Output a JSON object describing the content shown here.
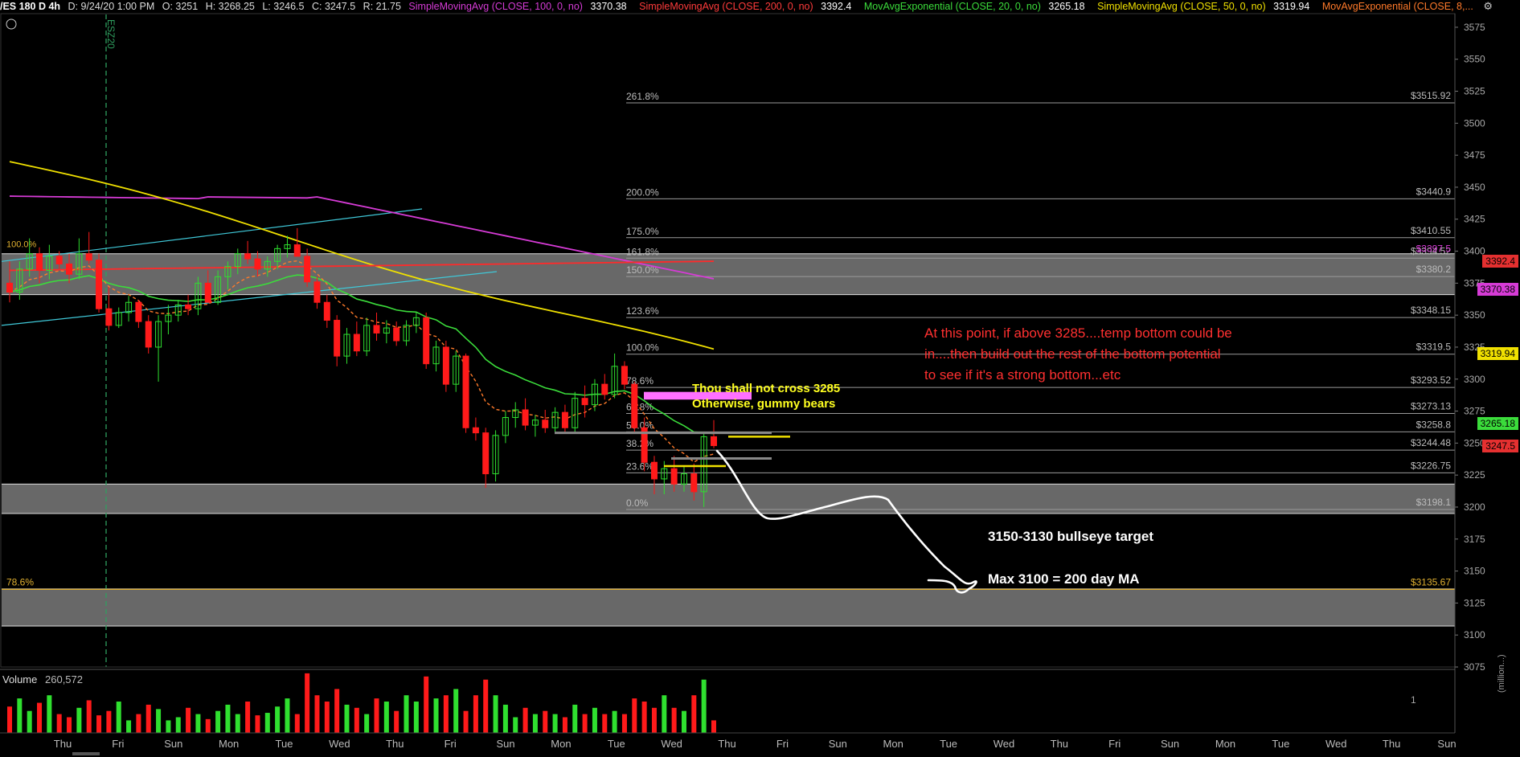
{
  "header": {
    "symbol": "/ES 180 D 4h",
    "date": "D: 9/24/20 1:00 PM",
    "open": "O: 3251",
    "high": "H: 3268.25",
    "low": "L: 3246.5",
    "close": "C: 3247.5",
    "range": "R: 21.75",
    "studies": [
      {
        "label": "SimpleMovingAvg (CLOSE, 100, 0, no)",
        "value": "3370.38",
        "color": "#d63bd6"
      },
      {
        "label": "SimpleMovingAvg (CLOSE, 200, 0, no)",
        "value": "3392.4",
        "color": "#ff3b3b"
      },
      {
        "label": "MovAvgExponential (CLOSE, 20, 0, no)",
        "value": "3265.18",
        "color": "#3bdc3b"
      },
      {
        "label": "SimpleMovingAvg (CLOSE, 50, 0, no)",
        "value": "3319.94",
        "color": "#f0e000"
      },
      {
        "label": "MovAvgExponential (CLOSE, 8,...",
        "value": "",
        "color": "#ff7a2a"
      }
    ],
    "expiry_label": "ESZ20"
  },
  "price_axis": [
    "3575",
    "3550",
    "3525",
    "3500",
    "3475",
    "3450",
    "3425",
    "3400",
    "3375",
    "3350",
    "3325",
    "3300",
    "3275",
    "3250",
    "3225",
    "3200",
    "3175",
    "3150",
    "3125",
    "3100",
    "3075"
  ],
  "fib_levels": [
    {
      "pct": "261.8%",
      "price": "$3515.92",
      "value": 3515.92
    },
    {
      "pct": "200.0%",
      "price": "$3440.9",
      "value": 3440.9
    },
    {
      "pct": "175.0%",
      "price": "$3410.55",
      "value": 3410.55
    },
    {
      "pct": "161.8%",
      "price": "$3394.52",
      "value": 3394.52
    },
    {
      "pct": "150.0%",
      "price": "$3380.2",
      "value": 3380.2
    },
    {
      "pct": "123.6%",
      "price": "$3348.15",
      "value": 3348.15
    },
    {
      "pct": "100.0%",
      "price": "$3319.5",
      "value": 3319.5
    },
    {
      "pct": "78.6%",
      "price": "$3293.52",
      "value": 3293.52
    },
    {
      "pct": "61.8%",
      "price": "$3273.13",
      "value": 3273.13
    },
    {
      "pct": "50.0%",
      "price": "$3258.8",
      "value": 3258.8
    },
    {
      "pct": "38.2%",
      "price": "$3244.48",
      "value": 3244.48
    },
    {
      "pct": "23.6%",
      "price": "$3226.75",
      "value": 3226.75
    },
    {
      "pct": "0.0%",
      "price": "$3198.1",
      "value": 3198.1
    }
  ],
  "extra_fib": {
    "pct": "78.6%",
    "price": "$3135.67",
    "value": 3135.67
  },
  "overlap_label": "$3397.5",
  "left_pct_label": "100.0%",
  "price_pills": [
    {
      "text": "3392.4",
      "value": 3392.4,
      "bg": "#e53030",
      "fg": "#000"
    },
    {
      "text": "3370.38",
      "value": 3370.38,
      "bg": "#d63bd6",
      "fg": "#000"
    },
    {
      "text": "3319.94",
      "value": 3319.94,
      "bg": "#f0e000",
      "fg": "#000"
    },
    {
      "text": "3265.18",
      "value": 3265.18,
      "bg": "#3bdc3b",
      "fg": "#000"
    },
    {
      "text": "3247.5",
      "value": 3247.5,
      "bg": "#e53030",
      "fg": "#000"
    }
  ],
  "annotations": {
    "red_note_1": "At this point, if above 3285....temp bottom could be",
    "red_note_2": "in....then build out the rest of the bottom potential",
    "red_note_3": "to see if it's a strong bottom...etc",
    "yellow_note_1": "Thou shall not cross 3285",
    "yellow_note_2": "Otherwise, gummy bears",
    "target_note": "3150-3130 bullseye target",
    "max_note": "Max 3100 = 200 day MA"
  },
  "volume": {
    "label": "Volume",
    "value": "260,572",
    "axis_top": "1",
    "axis_unit": "(million...)"
  },
  "time_axis": [
    "Thu",
    "Fri",
    "Sun",
    "Mon",
    "Tue",
    "Wed",
    "Thu",
    "Fri",
    "Sun",
    "Mon",
    "Tue",
    "Wed",
    "Thu",
    "Fri",
    "Sun",
    "Mon",
    "Tue",
    "Wed",
    "Thu",
    "Fri",
    "Sun",
    "Mon",
    "Tue",
    "Wed",
    "Thu",
    "Sun"
  ],
  "colors": {
    "up": "#2fe02f",
    "down": "#ff1a1a",
    "zone": "#7a7a7a",
    "fib_line": "#9a9a9a",
    "ma100": "#d63bd6",
    "ma200": "#ff2a2a",
    "ema20": "#3bdc3b",
    "ma50": "#f0e000",
    "ema8": "#ff7a2a",
    "channel": "#3fc8d8"
  },
  "chart_data": {
    "type": "candlestick",
    "title": "/ES 180 D 4h",
    "ylim": [
      3075,
      3585
    ],
    "candles": [
      {
        "o": 3375,
        "h": 3392,
        "l": 3360,
        "c": 3368
      },
      {
        "o": 3368,
        "h": 3392,
        "l": 3362,
        "c": 3386
      },
      {
        "o": 3386,
        "h": 3410,
        "l": 3380,
        "c": 3398
      },
      {
        "o": 3398,
        "h": 3403,
        "l": 3375,
        "c": 3385
      },
      {
        "o": 3385,
        "h": 3405,
        "l": 3378,
        "c": 3396
      },
      {
        "o": 3396,
        "h": 3400,
        "l": 3386,
        "c": 3390
      },
      {
        "o": 3390,
        "h": 3398,
        "l": 3375,
        "c": 3382
      },
      {
        "o": 3382,
        "h": 3410,
        "l": 3378,
        "c": 3398
      },
      {
        "o": 3398,
        "h": 3415,
        "l": 3390,
        "c": 3393
      },
      {
        "o": 3393,
        "h": 3398,
        "l": 3352,
        "c": 3355
      },
      {
        "o": 3355,
        "h": 3372,
        "l": 3338,
        "c": 3342
      },
      {
        "o": 3342,
        "h": 3356,
        "l": 3340,
        "c": 3352
      },
      {
        "o": 3352,
        "h": 3365,
        "l": 3345,
        "c": 3360
      },
      {
        "o": 3360,
        "h": 3362,
        "l": 3340,
        "c": 3345
      },
      {
        "o": 3345,
        "h": 3350,
        "l": 3320,
        "c": 3325
      },
      {
        "o": 3325,
        "h": 3350,
        "l": 3298,
        "c": 3345
      },
      {
        "o": 3345,
        "h": 3358,
        "l": 3335,
        "c": 3350
      },
      {
        "o": 3350,
        "h": 3362,
        "l": 3345,
        "c": 3358
      },
      {
        "o": 3358,
        "h": 3366,
        "l": 3350,
        "c": 3355
      },
      {
        "o": 3355,
        "h": 3380,
        "l": 3350,
        "c": 3375
      },
      {
        "o": 3375,
        "h": 3385,
        "l": 3365,
        "c": 3360
      },
      {
        "o": 3360,
        "h": 3385,
        "l": 3358,
        "c": 3380
      },
      {
        "o": 3380,
        "h": 3392,
        "l": 3370,
        "c": 3388
      },
      {
        "o": 3388,
        "h": 3402,
        "l": 3382,
        "c": 3398
      },
      {
        "o": 3398,
        "h": 3408,
        "l": 3390,
        "c": 3394
      },
      {
        "o": 3394,
        "h": 3400,
        "l": 3380,
        "c": 3386
      },
      {
        "o": 3386,
        "h": 3396,
        "l": 3380,
        "c": 3392
      },
      {
        "o": 3392,
        "h": 3405,
        "l": 3386,
        "c": 3402
      },
      {
        "o": 3402,
        "h": 3412,
        "l": 3395,
        "c": 3405
      },
      {
        "o": 3405,
        "h": 3418,
        "l": 3400,
        "c": 3396
      },
      {
        "o": 3396,
        "h": 3402,
        "l": 3372,
        "c": 3376
      },
      {
        "o": 3376,
        "h": 3380,
        "l": 3355,
        "c": 3360
      },
      {
        "o": 3360,
        "h": 3366,
        "l": 3340,
        "c": 3346
      },
      {
        "o": 3346,
        "h": 3350,
        "l": 3310,
        "c": 3318
      },
      {
        "o": 3318,
        "h": 3340,
        "l": 3312,
        "c": 3335
      },
      {
        "o": 3335,
        "h": 3345,
        "l": 3318,
        "c": 3322
      },
      {
        "o": 3322,
        "h": 3348,
        "l": 3318,
        "c": 3342
      },
      {
        "o": 3342,
        "h": 3352,
        "l": 3330,
        "c": 3336
      },
      {
        "o": 3336,
        "h": 3346,
        "l": 3328,
        "c": 3340
      },
      {
        "o": 3340,
        "h": 3345,
        "l": 3326,
        "c": 3330
      },
      {
        "o": 3330,
        "h": 3346,
        "l": 3326,
        "c": 3342
      },
      {
        "o": 3342,
        "h": 3352,
        "l": 3336,
        "c": 3348
      },
      {
        "o": 3348,
        "h": 3352,
        "l": 3308,
        "c": 3312
      },
      {
        "o": 3312,
        "h": 3330,
        "l": 3306,
        "c": 3325
      },
      {
        "o": 3325,
        "h": 3330,
        "l": 3290,
        "c": 3296
      },
      {
        "o": 3296,
        "h": 3322,
        "l": 3290,
        "c": 3318
      },
      {
        "o": 3318,
        "h": 3320,
        "l": 3258,
        "c": 3262
      },
      {
        "o": 3262,
        "h": 3270,
        "l": 3252,
        "c": 3258
      },
      {
        "o": 3258,
        "h": 3262,
        "l": 3215,
        "c": 3226
      },
      {
        "o": 3226,
        "h": 3260,
        "l": 3220,
        "c": 3256
      },
      {
        "o": 3256,
        "h": 3275,
        "l": 3250,
        "c": 3270
      },
      {
        "o": 3270,
        "h": 3282,
        "l": 3262,
        "c": 3276
      },
      {
        "o": 3276,
        "h": 3285,
        "l": 3260,
        "c": 3264
      },
      {
        "o": 3264,
        "h": 3272,
        "l": 3255,
        "c": 3268
      },
      {
        "o": 3268,
        "h": 3276,
        "l": 3258,
        "c": 3262
      },
      {
        "o": 3262,
        "h": 3278,
        "l": 3258,
        "c": 3274
      },
      {
        "o": 3274,
        "h": 3280,
        "l": 3258,
        "c": 3262
      },
      {
        "o": 3262,
        "h": 3290,
        "l": 3258,
        "c": 3285
      },
      {
        "o": 3285,
        "h": 3295,
        "l": 3270,
        "c": 3280
      },
      {
        "o": 3280,
        "h": 3300,
        "l": 3275,
        "c": 3296
      },
      {
        "o": 3296,
        "h": 3304,
        "l": 3284,
        "c": 3288
      },
      {
        "o": 3288,
        "h": 3320,
        "l": 3285,
        "c": 3310
      },
      {
        "o": 3310,
        "h": 3314,
        "l": 3292,
        "c": 3296
      },
      {
        "o": 3296,
        "h": 3298,
        "l": 3258,
        "c": 3262
      },
      {
        "o": 3262,
        "h": 3270,
        "l": 3228,
        "c": 3235
      },
      {
        "o": 3235,
        "h": 3240,
        "l": 3210,
        "c": 3222
      },
      {
        "o": 3222,
        "h": 3236,
        "l": 3210,
        "c": 3230
      },
      {
        "o": 3230,
        "h": 3240,
        "l": 3212,
        "c": 3218
      },
      {
        "o": 3218,
        "h": 3232,
        "l": 3212,
        "c": 3226
      },
      {
        "o": 3226,
        "h": 3234,
        "l": 3205,
        "c": 3212
      },
      {
        "o": 3212,
        "h": 3258,
        "l": 3200,
        "c": 3255
      },
      {
        "o": 3255,
        "h": 3268,
        "l": 3246,
        "c": 3248
      }
    ],
    "volume": [
      0.42,
      0.55,
      0.35,
      0.48,
      0.6,
      0.3,
      0.25,
      0.4,
      0.52,
      0.28,
      0.35,
      0.5,
      0.2,
      0.3,
      0.45,
      0.38,
      0.2,
      0.25,
      0.4,
      0.3,
      0.22,
      0.35,
      0.45,
      0.3,
      0.5,
      0.28,
      0.32,
      0.42,
      0.55,
      0.3,
      0.95,
      0.6,
      0.5,
      0.7,
      0.45,
      0.4,
      0.3,
      0.55,
      0.5,
      0.35,
      0.6,
      0.5,
      0.9,
      0.55,
      0.6,
      0.7,
      0.35,
      0.6,
      0.85,
      0.6,
      0.45,
      0.25,
      0.4,
      0.3,
      0.35,
      0.3,
      0.25,
      0.45,
      0.3,
      0.4,
      0.3,
      0.35,
      0.3,
      0.55,
      0.5,
      0.4,
      0.6,
      0.4,
      0.35,
      0.6,
      0.85,
      0.2
    ]
  }
}
